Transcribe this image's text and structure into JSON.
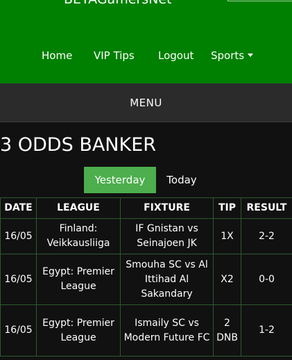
{
  "header": {
    "site_title": "BETAGamersNet",
    "nav": [
      {
        "label": "Home"
      },
      {
        "label": "VIP Tips"
      },
      {
        "label": "Logout"
      },
      {
        "label": "Sports"
      }
    ]
  },
  "menu_label": "MENU",
  "page_title": "3 ODDS BANKER",
  "tabs": [
    {
      "label": "Yesterday",
      "active": true
    },
    {
      "label": "Today",
      "active": false
    }
  ],
  "table": {
    "headers": [
      "DATE",
      "LEAGUE",
      "FIXTURE",
      "TIP",
      "RESULT"
    ],
    "rows": [
      {
        "date": "16/05",
        "league": "Finland: Veikkausliiga",
        "fixture": "IF Gnistan vs Seinajoen JK",
        "tip": "1X",
        "result": "2-2"
      },
      {
        "date": "16/05",
        "league": "Egypt: Premier League",
        "fixture": "Smouha SC vs Al Ittihad Al Sakandary",
        "tip": "X2",
        "result": "0-0"
      },
      {
        "date": "16/05",
        "league": "Egypt: Premier League",
        "fixture": "Ismaily SC vs Modern Future FC",
        "tip": "2 DNB",
        "result": "1-2"
      }
    ]
  },
  "colors": {
    "header_bg": "#008000",
    "menu_bg": "#2b2b2b",
    "page_bg": "#111111",
    "active_tab": "#4cae4c",
    "table_border": "#2e5a2e"
  },
  "icons": {
    "sports_dropdown": "caret-down-icon"
  }
}
